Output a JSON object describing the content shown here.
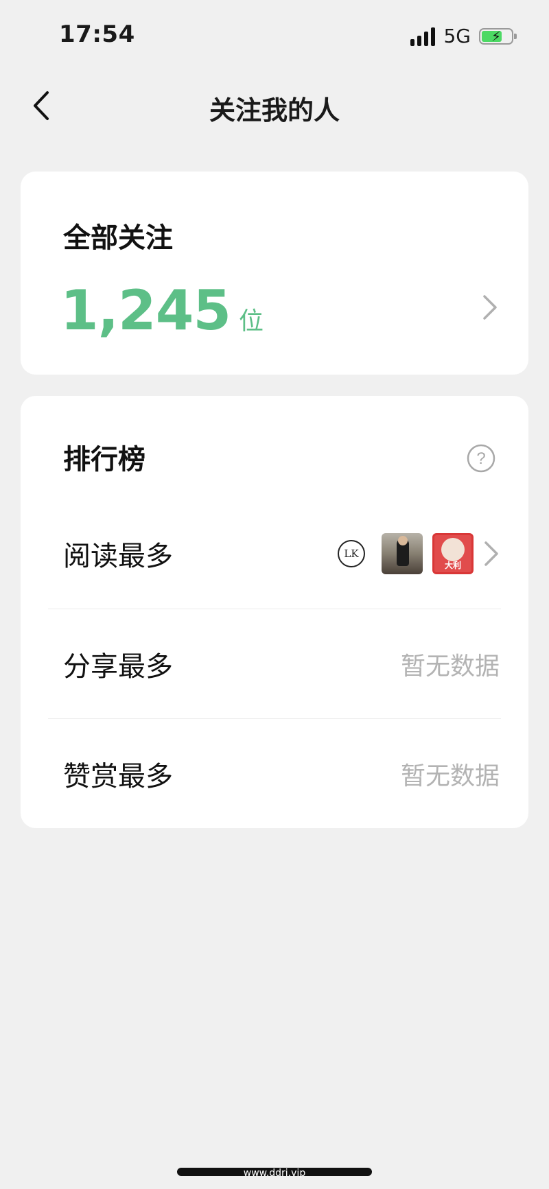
{
  "status_bar": {
    "time": "17:54",
    "network": "5G",
    "signal_icon": "signal-bars-icon",
    "battery_icon": "battery-charging-icon",
    "battery_color": "#4cd964"
  },
  "nav": {
    "title": "关注我的人",
    "back_icon": "chevron-left-icon"
  },
  "all_followers": {
    "title": "全部关注",
    "count": "1,245",
    "unit": "位",
    "accent_color": "#5dbf87",
    "chevron_icon": "chevron-right-icon"
  },
  "ranking": {
    "title": "排行榜",
    "help_icon": "question-circle-icon",
    "rows": [
      {
        "label": "阅读最多",
        "avatars": [
          "avatar-lk-logo",
          "avatar-photo-person",
          "avatar-red-badge"
        ],
        "avatar_text": {
          "lk": "LK",
          "red": "大利"
        },
        "chevron_icon": "chevron-right-icon"
      },
      {
        "label": "分享最多",
        "empty_text": "暂无数据"
      },
      {
        "label": "赞赏最多",
        "empty_text": "暂无数据"
      }
    ]
  },
  "footer": {
    "watermark": "www.ddri.vip"
  }
}
